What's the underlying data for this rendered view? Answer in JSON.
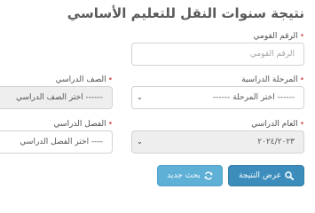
{
  "title": "نتيجة سنوات النقل للتعليم الأساسي",
  "national_id": {
    "label": "الرقم القومي",
    "placeholder": "الرقم القومي",
    "value": ""
  },
  "stage": {
    "label": "المرحلة الدراسية",
    "selected": "------ اختر المرحلة ------"
  },
  "grade": {
    "label": "الصف الدراسي",
    "selected": "------ اختر الصف الدراسي"
  },
  "year": {
    "label": "العام الدراسي",
    "selected": "٢٠٢٤/٢٠٢٣"
  },
  "semester": {
    "label": "الفصل الدراسي",
    "selected": "---- اختر الفصل الدراسي"
  },
  "buttons": {
    "show_result": "عرض النتيجة",
    "new_search": "بحث جديد"
  },
  "required_mark": "•",
  "colors": {
    "primary": "#3c8dbc",
    "info": "#5fb0d6",
    "required": "#d9534f"
  }
}
